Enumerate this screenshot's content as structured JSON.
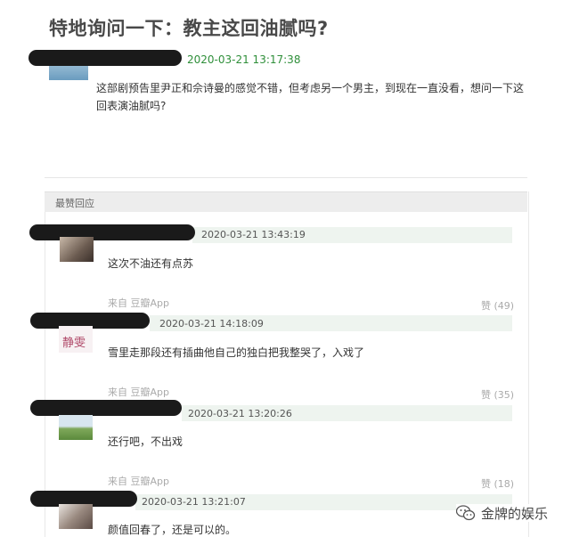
{
  "post": {
    "title": "特地询问一下：教主这回油腻吗?",
    "date": "2020-03-21 13:17:38",
    "body": "这部剧预告里尹正和佘诗曼的感觉不错，但考虑另一个男主，到现在一直没看，想问一下这回表演油腻吗?"
  },
  "section_header": "最赞回应",
  "comments": [
    {
      "date": "2020-03-21 13:43:19",
      "text": "这次不油还有点苏",
      "source": "来自 豆瓣App",
      "likes": "赞 (49)"
    },
    {
      "date": "2020-03-21 14:18:09",
      "text": "雪里走那段还有插曲他自己的独白把我整哭了，入戏了",
      "source": "来自 豆瓣App",
      "likes": "赞 (35)"
    },
    {
      "date": "2020-03-21 13:20:26",
      "text": "还行吧，不出戏",
      "source": "来自 豆瓣App",
      "likes": "赞 (18)"
    },
    {
      "date": "2020-03-21 13:21:07",
      "text": "颜值回春了，还是可以的。"
    }
  ],
  "avatar_text": "静雯",
  "watermark": "金牌的娱乐",
  "colors": {
    "date_green": "#2f8f3a",
    "meta_bar": "#eef4ef",
    "header_bg": "#ededed"
  }
}
